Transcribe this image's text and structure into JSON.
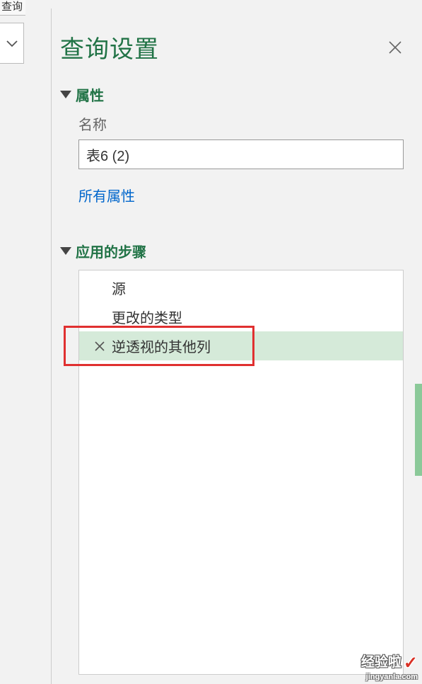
{
  "top_fragment": "查询",
  "panel": {
    "title": "查询设置",
    "close_label": "关闭"
  },
  "properties": {
    "section_title": "属性",
    "name_label": "名称",
    "name_value": "表6 (2)",
    "all_properties_link": "所有属性"
  },
  "steps": {
    "section_title": "应用的步骤",
    "items": [
      {
        "label": "源",
        "selected": false
      },
      {
        "label": "更改的类型",
        "selected": false
      },
      {
        "label": "逆透视的其他列",
        "selected": true
      }
    ]
  },
  "watermark": {
    "main": "经验啦",
    "sub": "jingyanla.com"
  }
}
